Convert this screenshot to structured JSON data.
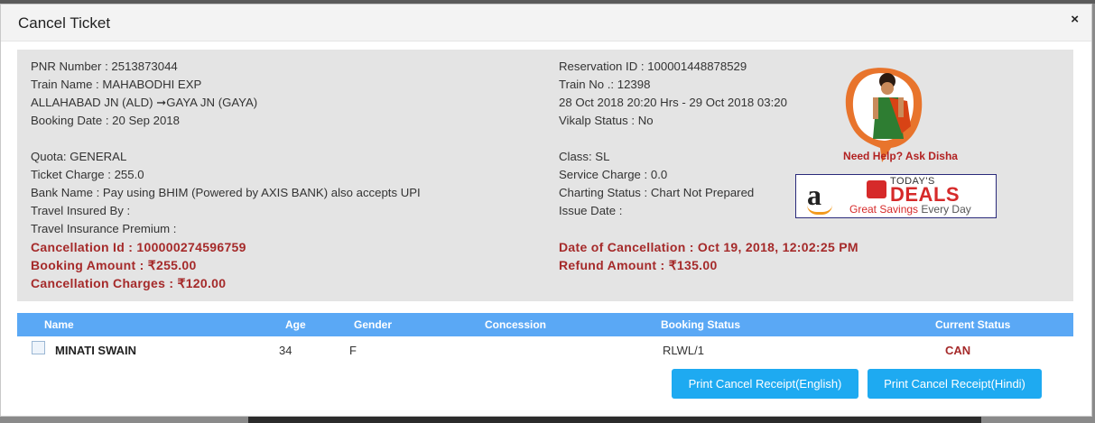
{
  "dialog": {
    "title": "Cancel Ticket",
    "close_icon": "×"
  },
  "left": {
    "pnr": "PNR Number : 2513873044",
    "train_name": "Train Name : MAHABODHI EXP",
    "route": "ALLAHABAD JN (ALD) ➞GAYA JN (GAYA)",
    "booking_date": "Booking Date : 20 Sep 2018",
    "quota": "Quota: GENERAL",
    "ticket_charge": "Ticket Charge : 255.0",
    "bank_name": "Bank Name : Pay using BHIM (Powered by AXIS BANK) also accepts UPI",
    "travel_insured": "Travel Insured By :",
    "travel_premium": "Travel Insurance Premium :",
    "cancellation_id": "Cancellation Id : 100000274596759",
    "booking_amount": "Booking Amount : ₹255.00",
    "cancellation_charges": "Cancellation Charges : ₹120.00"
  },
  "right": {
    "reservation_id": "Reservation ID : 100001448878529",
    "train_no": "Train No .: 12398",
    "journey_time": "28 Oct 2018 20:20 Hrs - 29 Oct 2018 03:20",
    "vikalp": "Vikalp Status : No",
    "class": "Class: SL",
    "service_charge": "Service Charge : 0.0",
    "charting_status": "Charting Status : Chart Not Prepared",
    "issue_date": "Issue Date :",
    "date_of_cancellation": "Date of Cancellation : Oct 19, 2018, 12:02:25 PM",
    "refund_amount": "Refund Amount : ₹135.00"
  },
  "disha": {
    "label": "Need Help? Ask Disha"
  },
  "deals_banner": {
    "top": "TODAY'S",
    "main": "DEALS",
    "sub_red": "Great Savings",
    "sub_grey": "Every Day",
    "logo_letter": "a"
  },
  "table": {
    "headers": [
      "Name",
      "Age",
      "Gender",
      "Concession",
      "Booking Status",
      "Current Status"
    ],
    "rows": [
      {
        "name": "MINATI SWAIN",
        "age": "34",
        "gender": "F",
        "concession": "",
        "booking_status": "RLWL/1",
        "current_status": "CAN"
      }
    ]
  },
  "buttons": {
    "print_english": "Print Cancel Receipt(English)",
    "print_hindi": "Print Cancel Receipt(Hindi)"
  },
  "colors": {
    "accent": "#1eaaf1",
    "header_bar": "#5aa8f5",
    "emphasis_red": "#a52a2a"
  }
}
